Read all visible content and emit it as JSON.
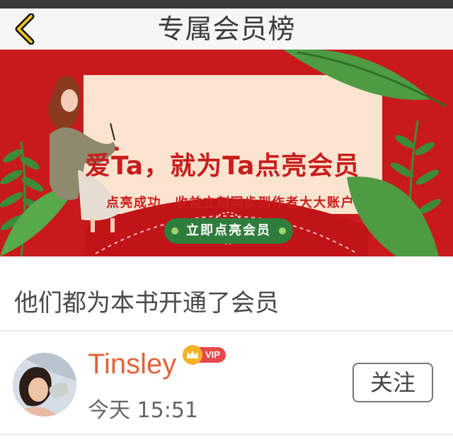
{
  "nav": {
    "title": "专属会员榜",
    "back_icon": "chevron-left-icon"
  },
  "banner": {
    "headline": "爱Ta，就为Ta点亮会员",
    "subtitle": "点亮成功，收益立刻同步到作者大大账户",
    "button_label": "立即点亮会员"
  },
  "section": {
    "title": "他们都为本书开通了会员"
  },
  "members": [
    {
      "name": "Tinsley",
      "vip_label": "VIP",
      "time": "今天 15:51",
      "follow_label": "关注"
    }
  ],
  "colors": {
    "banner_red": "#c8191d",
    "name_orange": "#e2643b",
    "vip_red": "#e8484a",
    "button_green": "#2e7d3c"
  }
}
